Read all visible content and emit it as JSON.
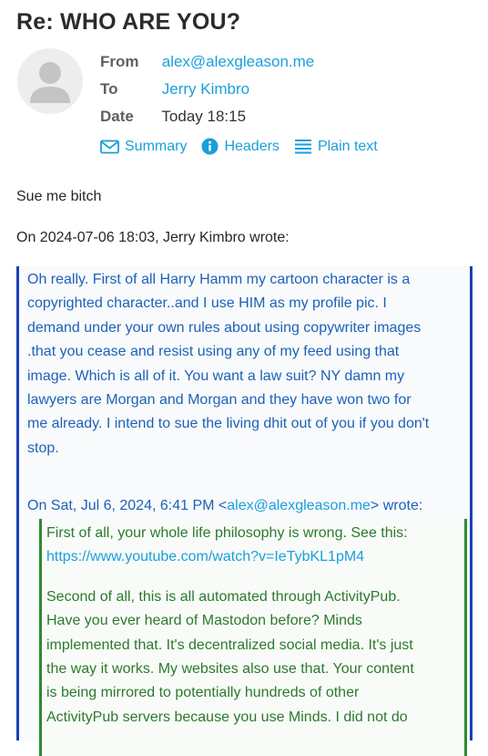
{
  "message": {
    "subject": "Re: WHO ARE YOU?",
    "from_label": "From",
    "from_value": "alex@alexgleason.me",
    "to_label": "To",
    "to_value": "Jerry Kimbro",
    "date_label": "Date",
    "date_value": "Today 18:15",
    "avatar_icon": "person-icon"
  },
  "tabs": [
    {
      "label": "Summary",
      "icon": "envelope-icon"
    },
    {
      "label": "Headers",
      "icon": "info-icon"
    },
    {
      "label": "Plain text",
      "icon": "lines-icon"
    }
  ],
  "body": {
    "reply": "Sue me bitch",
    "attribution": "On 2024-07-06 18:03, Jerry Kimbro wrote:"
  },
  "quote1": {
    "lines": [
      "Oh really. First of all Harry Hamm my cartoon character is a",
      "copyrighted character..and I use HIM as my profile pic. I",
      "demand under your own rules about using copywriter images",
      ".that you cease and resist using any of my feed using that",
      "image. Which is all of it. You want a law suit? NY damn my",
      "lawyers are Morgan and Morgan and they have won two for",
      "me already. I intend to sue the living dhit out of you if you don't",
      "stop."
    ],
    "attrib_prefix": "On Sat, Jul 6, 2024, 6:41 PM <",
    "attrib_email": "alex@alexgleason.me",
    "attrib_suffix": "> wrote:"
  },
  "quote2": {
    "line1": "First of all, your whole life philosophy is wrong. See this:",
    "link": "https://www.youtube.com/watch?v=IeTybKL1pM4",
    "para2": [
      "Second of all, this is all automated through ActivityPub.",
      "Have you ever heard of Mastodon before? Minds",
      "implemented that. It's decentralized social media. It's just",
      "the way it works. My websites also use that. Your content",
      "is being mirrored to potentially hundreds of other",
      "ActivityPub servers because you use Minds. I did not do"
    ]
  },
  "colors": {
    "link": "#1a9fdb",
    "quote1_border": "#1a3fb8",
    "quote1_text": "#1c62b8",
    "quote2_border": "#2e8b2e",
    "quote2_text": "#2b7a2b"
  }
}
